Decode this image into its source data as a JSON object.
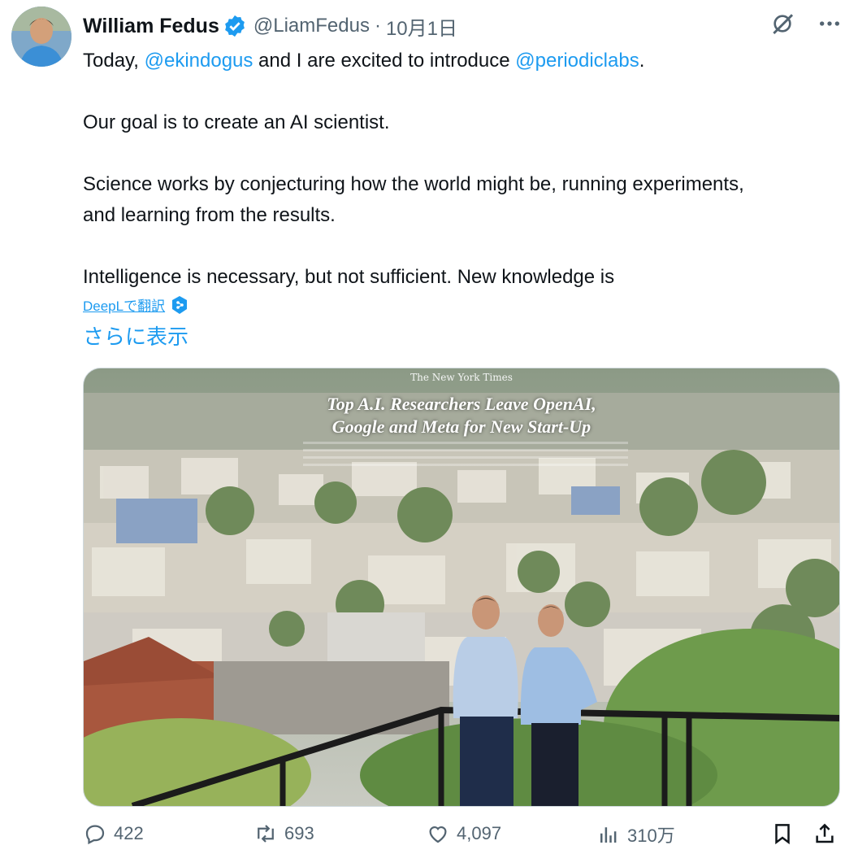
{
  "author": {
    "name": "William Fedus",
    "handle": "@LiamFedus",
    "separator": "·",
    "date": "10月1日"
  },
  "tweet": {
    "line1_prefix": "Today, ",
    "mention1": "@ekindogus",
    "line1_middle": " and I are excited to introduce ",
    "mention2": "@periodiclabs",
    "line1_suffix": ".",
    "para2": "Our goal is to create an AI scientist.",
    "para3_line1": "Science works by conjecturing how the world might be, running experiments,",
    "para3_line2": "and learning from the results.",
    "para4": "Intelligence is necessary, but not sufficient. New knowledge is"
  },
  "translate_link": "DeepLで翻訳",
  "show_more": "さらに表示",
  "media": {
    "publisher": "The New York Times",
    "headline_line1": "Top A.I. Researchers Leave OpenAI,",
    "headline_line2": "Google and Meta for New Start-Up"
  },
  "actions": {
    "replies": "422",
    "reposts": "693",
    "likes": "4,097",
    "views": "310万"
  },
  "icons": [
    "verified-badge-icon",
    "grok-icon",
    "more-icon",
    "deepl-icon",
    "reply-icon",
    "repost-icon",
    "like-icon",
    "views-icon",
    "bookmark-icon",
    "share-icon"
  ],
  "colors": {
    "accent": "#1d9bf0",
    "muted": "#536471",
    "text": "#0f1419"
  }
}
